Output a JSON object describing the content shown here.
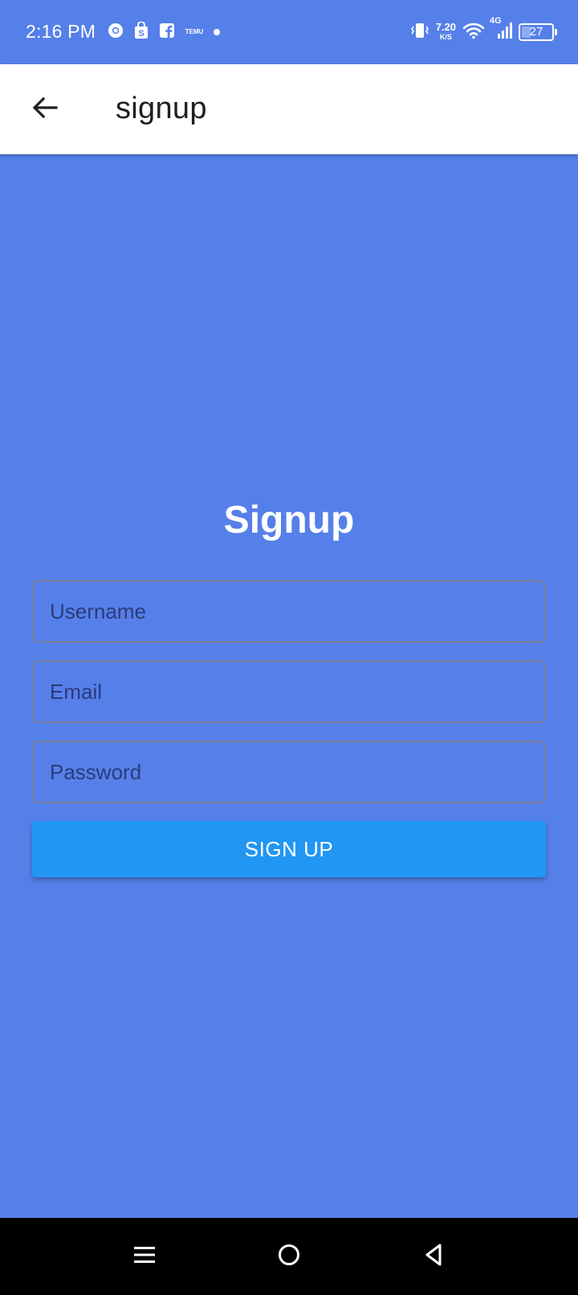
{
  "status_bar": {
    "time": "2:16 PM",
    "left_icons": [
      "chrome-icon",
      "shopping-bag-icon",
      "facebook-icon",
      "temu-icon",
      "notification-dot-icon"
    ],
    "temu_label": "TEMU",
    "net_speed_value": "7.20",
    "net_speed_unit": "K/S",
    "network_type": "4G",
    "battery_level": "27",
    "right_icons": [
      "vibrate-icon",
      "wifi-icon",
      "signal-icon",
      "battery-icon"
    ]
  },
  "app_bar": {
    "back_icon": "back-arrow-icon",
    "title": "signup"
  },
  "form": {
    "heading": "Signup",
    "username_placeholder": "Username",
    "email_placeholder": "Email",
    "password_placeholder": "Password",
    "submit_label": "SIGN UP"
  },
  "nav_bar": {
    "icons": [
      "menu-icon",
      "home-icon",
      "back-icon"
    ]
  },
  "colors": {
    "background": "#5680E9",
    "app_bar": "#FFFFFF",
    "button": "#2196F3",
    "nav_bar": "#000000"
  }
}
